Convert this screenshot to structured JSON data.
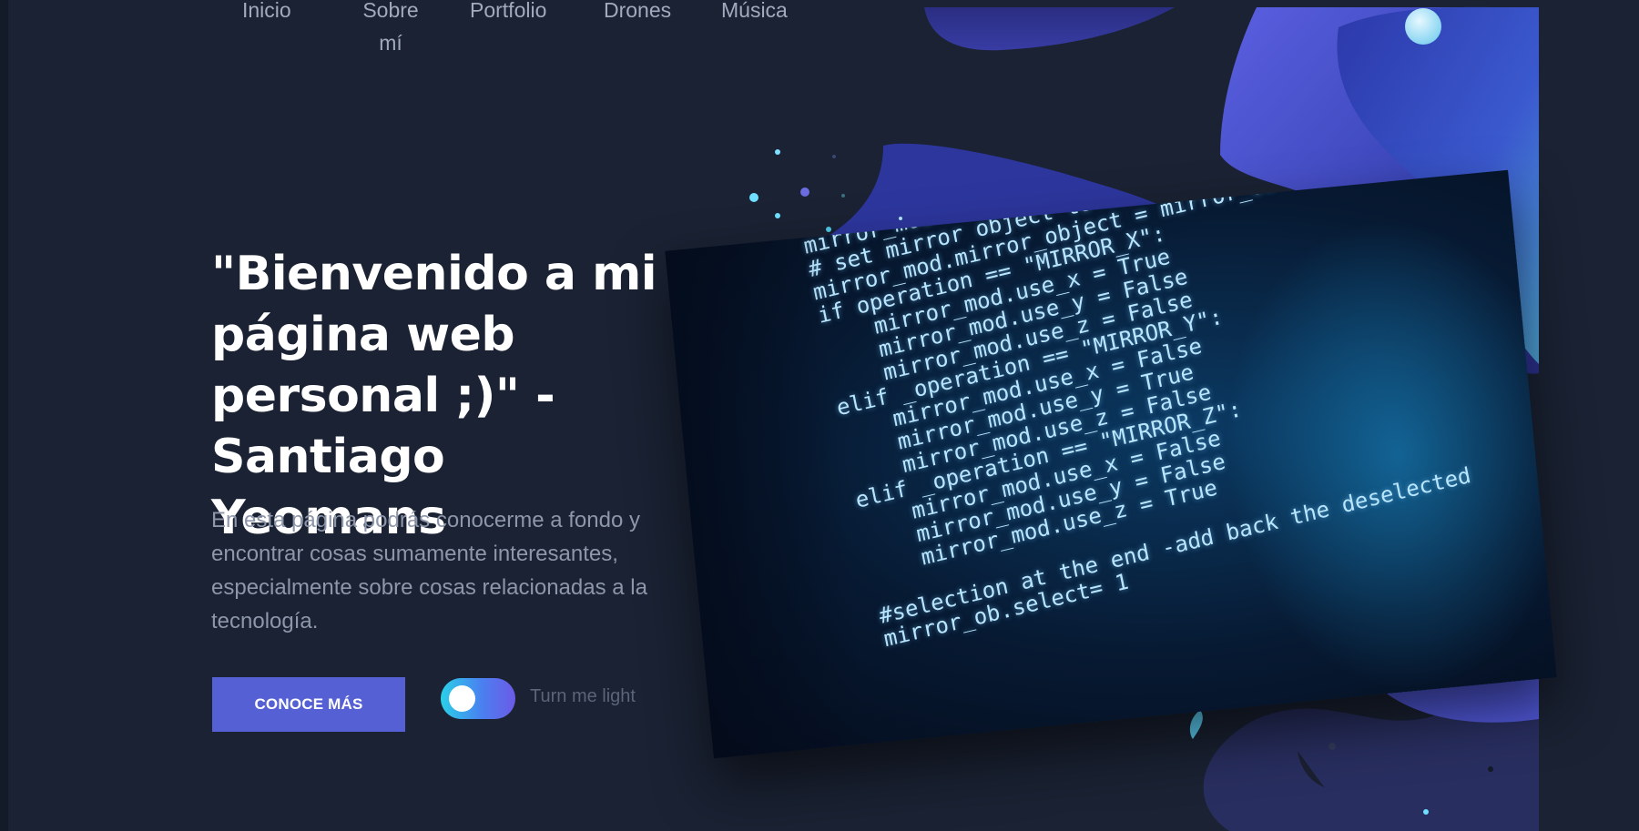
{
  "nav": {
    "items": [
      {
        "label": "Inicio"
      },
      {
        "label": "Sobre mí"
      },
      {
        "label": "Portfolio"
      },
      {
        "label": "Drones"
      },
      {
        "label": "Música"
      }
    ]
  },
  "hero": {
    "title": "\"Bienvenido a mi página web personal ;)\" - Santiago Yeomans",
    "description": "En esta página podrás conocerme a fondo y encontrar cosas sumamente interesantes, especialmente sobre cosas relacionadas a la tecnología.",
    "cta_label": "CONOCE MÁS",
    "toggle_label": "Turn me light"
  },
  "illustration": {
    "code_lines": [
      "mirror_mod = modifier_ob.modifiers.new(\"mirror_mod\"",
      "# set mirror object to mirror_ob",
      "mirror_mod.mirror_object = mirror_ob",
      "if operation == \"MIRROR_X\":",
      "    mirror_mod.use_x = True",
      "    mirror_mod.use_y = False",
      "    mirror_mod.use_z = False",
      "elif _operation == \"MIRROR_Y\":",
      "    mirror_mod.use_x = False",
      "    mirror_mod.use_y = True",
      "    mirror_mod.use_z = False",
      "elif _operation == \"MIRROR_Z\":",
      "    mirror_mod.use_x = False",
      "    mirror_mod.use_y = False",
      "    mirror_mod.use_z = True",
      "",
      "#selection at the end -add back the deselected",
      "mirror_ob.select= 1"
    ]
  },
  "colors": {
    "background": "#1a2233",
    "accent": "#5560d4",
    "text_primary": "#ffffff",
    "text_secondary": "#8e97aa"
  }
}
